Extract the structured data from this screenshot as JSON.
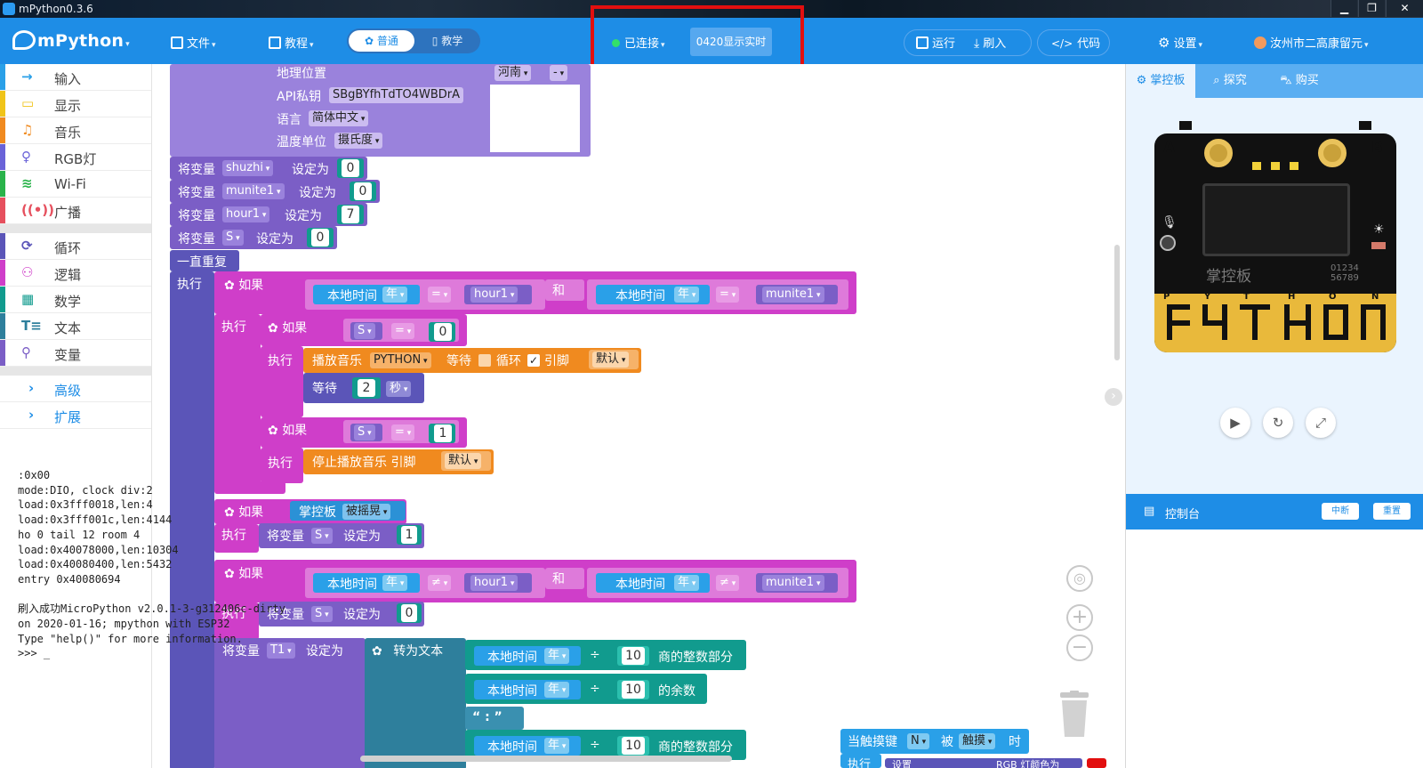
{
  "window": {
    "title": "mPython0.3.6",
    "min": "▁",
    "max": "❐",
    "close": "✕"
  },
  "toolbar": {
    "logo": "mPython",
    "file": "文件",
    "tutorial": "教程",
    "mode_normal": "普通",
    "mode_teach": "教学",
    "connected": "已连接",
    "device_name": "0420显示实时",
    "run": "运行",
    "flash": "刷入",
    "code": "代码",
    "settings": "设置",
    "user": "汝州市二高康留元"
  },
  "sidebar": {
    "items": [
      {
        "label": "输入",
        "icon": "→",
        "color": "#2aa0e8"
      },
      {
        "label": "显示",
        "icon": "▭",
        "color": "#f0c419"
      },
      {
        "label": "音乐",
        "icon": "♫",
        "color": "#f08a1f"
      },
      {
        "label": "RGB灯",
        "icon": "♀",
        "color": "#6a63d8"
      },
      {
        "label": "Wi-Fi",
        "icon": "≋",
        "color": "#29b34a"
      },
      {
        "label": "广播",
        "icon": "((•))",
        "color": "#e6505e"
      }
    ],
    "items2": [
      {
        "label": "循环",
        "icon": "⟳",
        "color": "#5b55b8"
      },
      {
        "label": "逻辑",
        "icon": "⚇",
        "color": "#cf3ec9"
      },
      {
        "label": "数学",
        "icon": "▦",
        "color": "#119b8e"
      },
      {
        "label": "文本",
        "icon": "T≡",
        "color": "#2e7f9c"
      },
      {
        "label": "变量",
        "icon": "⚲",
        "color": "#7b5ec6"
      }
    ],
    "advanced": [
      {
        "label": "高级",
        "icon": "›"
      },
      {
        "label": "扩展",
        "icon": "›"
      }
    ]
  },
  "blocks": {
    "geo_label": "地理位置",
    "geo_value": "河南",
    "geo_dash": "-",
    "api_label": "API私钥",
    "api_value": "SBgBYfhTdTO4WBDrA",
    "lang_label": "语言",
    "lang_value": "简体中文",
    "temp_label": "温度单位",
    "temp_value": "摄氏度",
    "set_var": "将变量",
    "set_to": "设定为",
    "vars": [
      {
        "name": "shuzhi",
        "value": "0"
      },
      {
        "name": "munite1",
        "value": "0"
      },
      {
        "name": "hour1",
        "value": "7"
      },
      {
        "name": "S",
        "value": "0"
      }
    ],
    "forever": "一直重复",
    "do": "执行",
    "if": "如果",
    "and": "和",
    "local_time": "本地时间",
    "year": "年",
    "eq": "=",
    "neq": "≠",
    "hour1": "hour1",
    "munite1": "munite1",
    "S": "S",
    "zero": "0",
    "one": "1",
    "play_music": "播放音乐",
    "music_name": "PYTHON",
    "wait": "等待",
    "loop": "循环",
    "pin": "引脚",
    "default": "默认",
    "wait_label": "等待",
    "wait_value": "2",
    "sec": "秒",
    "stop_music": "停止播放音乐 引脚",
    "board": "掌控板",
    "shaken": "被摇晃",
    "T1": "T1",
    "to_text": "转为文本",
    "div": "÷",
    "ten": "10",
    "int_part": "商的整数部分",
    "remainder": "的余数",
    "colon_text": "“ : ”",
    "touch_when": "当触摸键",
    "touch_key": "N",
    "touch_by": "被",
    "touch_action": "触摸",
    "touch_time": "时",
    "rgb_set": "设置",
    "rgb_label": "RGB 灯颜色为"
  },
  "right": {
    "tab_board": "掌控板",
    "tab_explore": "探究",
    "tab_buy": "购买",
    "btn_a": "A",
    "btn_b": "B",
    "board_logo": "掌控板",
    "board_num1": "01234",
    "board_num2": "56789",
    "gold_letters": [
      "P",
      "Y",
      "T",
      "H",
      "O",
      "N"
    ],
    "console_title": "控制台",
    "interrupt": "中断",
    "reset": "重置",
    "console_lines": [
      ":0x00",
      "mode:DIO, clock div:2",
      "load:0x3fff0018,len:4",
      "load:0x3fff001c,len:4144",
      "ho 0 tail 12 room 4",
      "load:0x40078000,len:10304",
      "load:0x40080400,len:5432",
      "entry 0x40080694",
      "",
      "刷入成功MicroPython v2.0.1-3-g312406c-dirty on 2020-01-16; mpython with ESP32",
      "Type \"help()\" for more information.",
      ">>> _"
    ]
  }
}
